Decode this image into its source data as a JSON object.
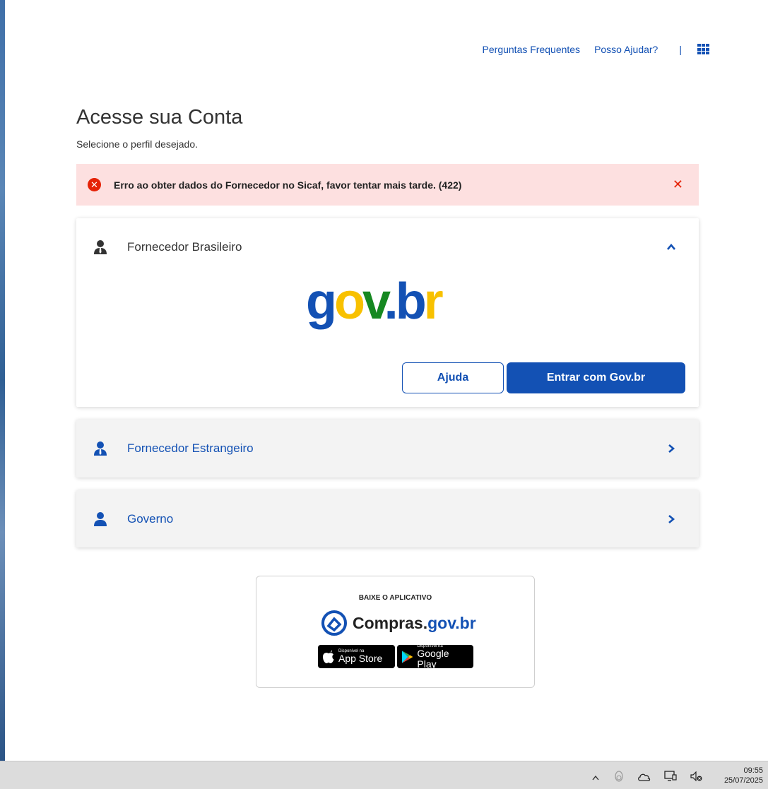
{
  "topnav": {
    "faq": "Perguntas Frequentes",
    "help": "Posso Ajudar?",
    "separator": "|",
    "apps_icon": "grid-icon"
  },
  "header": {
    "title": "Acesse sua Conta",
    "subtitle": "Selecione o perfil desejado."
  },
  "alert": {
    "message": "Erro ao obter dados do Fornecedor no Sicaf, favor tentar mais tarde. (422)",
    "icon": "error-circle-icon",
    "close_icon": "close-icon",
    "color": "#e52207",
    "background": "#fde0e0"
  },
  "profiles": [
    {
      "label": "Fornecedor Brasileiro",
      "expanded": true,
      "logo": "gov.br",
      "help_button": "Ajuda",
      "enter_button": "Entrar com Gov.br"
    },
    {
      "label": "Fornecedor Estrangeiro",
      "expanded": false
    },
    {
      "label": "Governo",
      "expanded": false
    }
  ],
  "app_promo": {
    "caption": "BAIXE O APLICATIVO",
    "brand_main": "Compras.",
    "brand_suffix": "gov.br",
    "appstore_small": "Disponível na",
    "appstore_big": "App Store",
    "googleplay_small": "Disponível na",
    "googleplay_big": "Google Play"
  },
  "taskbar": {
    "time": "09:55",
    "date": "25/07/2025"
  },
  "colors": {
    "primary": "#1351b4",
    "gov_yellow": "#f8c100",
    "gov_green": "#168821"
  }
}
